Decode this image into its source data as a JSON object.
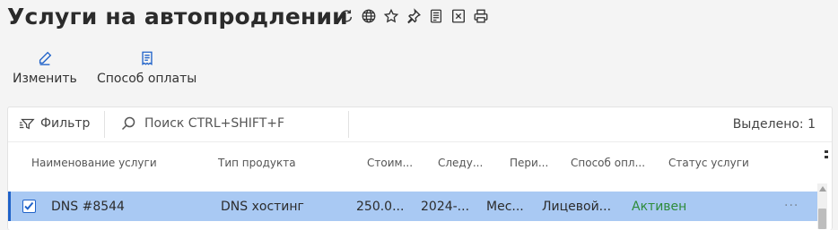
{
  "page": {
    "title": "Услуги на автопродлении",
    "title_icons": [
      "refresh-icon",
      "globe-icon",
      "star-icon",
      "pin-icon",
      "document-icon",
      "excel-icon",
      "print-icon"
    ]
  },
  "toolbar": {
    "edit_label": "Изменить",
    "payment_method_label": "Способ оплаты"
  },
  "filterbar": {
    "filter_label": "Фильтр",
    "search_placeholder": "Поиск CTRL+SHIFT+F",
    "selected_text": "Выделено: 1"
  },
  "table": {
    "columns": [
      "Наименование услуги",
      "Тип продукта",
      "Стоим...",
      "Следу...",
      "Пери...",
      "Способ опл...",
      "Статус услуги"
    ],
    "rows": [
      {
        "checked": true,
        "name": "DNS #8544",
        "product_type": "DNS хостинг",
        "cost": "250.0...",
        "next": "2024-...",
        "period": "Мес...",
        "payment_method": "Лицевой...",
        "status": "Активен"
      }
    ],
    "more_label": "···"
  },
  "colors": {
    "selected_row_bg": "#a9c9f3",
    "accent_blue": "#1f62c9",
    "status_active": "#2e8b3a"
  }
}
